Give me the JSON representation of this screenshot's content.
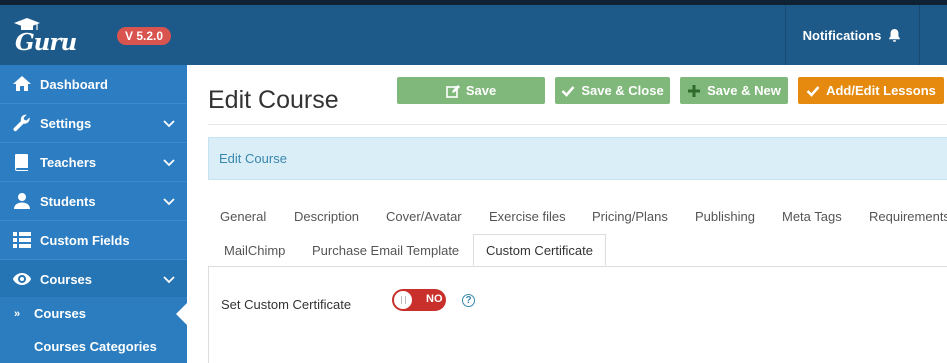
{
  "header": {
    "logo_text": "Guru",
    "version": "V 5.2.0",
    "notifications_label": "Notifications"
  },
  "sidebar": {
    "items": [
      {
        "label": "Dashboard",
        "icon": "home-icon",
        "expandable": false
      },
      {
        "label": "Settings",
        "icon": "wrench-icon",
        "expandable": true
      },
      {
        "label": "Teachers",
        "icon": "book-icon",
        "expandable": true
      },
      {
        "label": "Students",
        "icon": "user-icon",
        "expandable": true
      },
      {
        "label": "Custom Fields",
        "icon": "list-icon",
        "expandable": false
      },
      {
        "label": "Courses",
        "icon": "eye-icon",
        "expandable": true
      }
    ],
    "sub_items": [
      {
        "label": "Courses",
        "active": true
      },
      {
        "label": "Courses Categories",
        "active": false
      }
    ]
  },
  "main": {
    "title": "Edit Course",
    "buttons": {
      "save": "Save",
      "save_close": "Save & Close",
      "save_new": "Save & New",
      "add_edit_lessons": "Add/Edit Lessons"
    },
    "alert": "Edit Course",
    "tabs_row1": [
      "General",
      "Description",
      "Cover/Avatar",
      "Exercise files",
      "Pricing/Plans",
      "Publishing",
      "Meta Tags",
      "Requirements"
    ],
    "tabs_row2": [
      "MailChimp",
      "Purchase Email Template",
      "Custom Certificate"
    ],
    "active_tab": "Custom Certificate",
    "field": {
      "label": "Set Custom Certificate",
      "toggle_value": "NO",
      "help": "?"
    }
  },
  "colors": {
    "topbar": "#1d5a8a",
    "sidebar": "#2b7cbf",
    "button_green": "#80b77a",
    "button_orange": "#e58a0e",
    "toggle_off": "#c9302c",
    "version_badge": "#d9534f"
  }
}
